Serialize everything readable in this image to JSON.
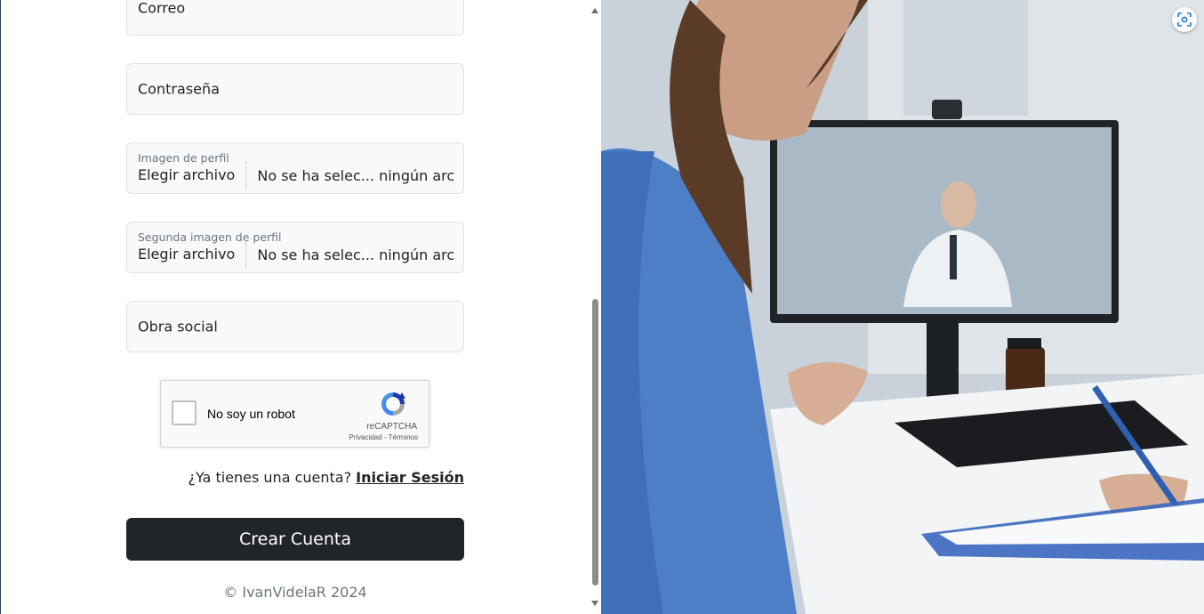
{
  "form": {
    "email_label": "Correo",
    "password_label": "Contraseña",
    "profile_image": {
      "label": "Imagen de perfil",
      "button": "Elegir archivo",
      "status": "No se ha selec... ningún archivo"
    },
    "second_profile_image": {
      "label": "Segunda imagen de perfil",
      "button": "Elegir archivo",
      "status": "No se ha selec... ningún archivo"
    },
    "health_insurance_label": "Obra social"
  },
  "recaptcha": {
    "label": "No soy un robot",
    "brand": "reCAPTCHA",
    "privacy": "Privacidad",
    "separator": " - ",
    "terms": "Términos"
  },
  "login_prompt": {
    "text": "¿Ya tienes una cuenta?",
    "link": "Iniciar Sesión"
  },
  "submit_label": "Crear Cuenta",
  "footer": {
    "copyright": "© IvanVidelaR 2024"
  },
  "icons": {
    "recaptcha_logo": "recaptcha-logo-icon",
    "lens": "google-lens-icon"
  },
  "colors": {
    "button_bg": "#212529",
    "field_bg": "#f8f9fa",
    "scrub_blue": "#4a78c2"
  }
}
